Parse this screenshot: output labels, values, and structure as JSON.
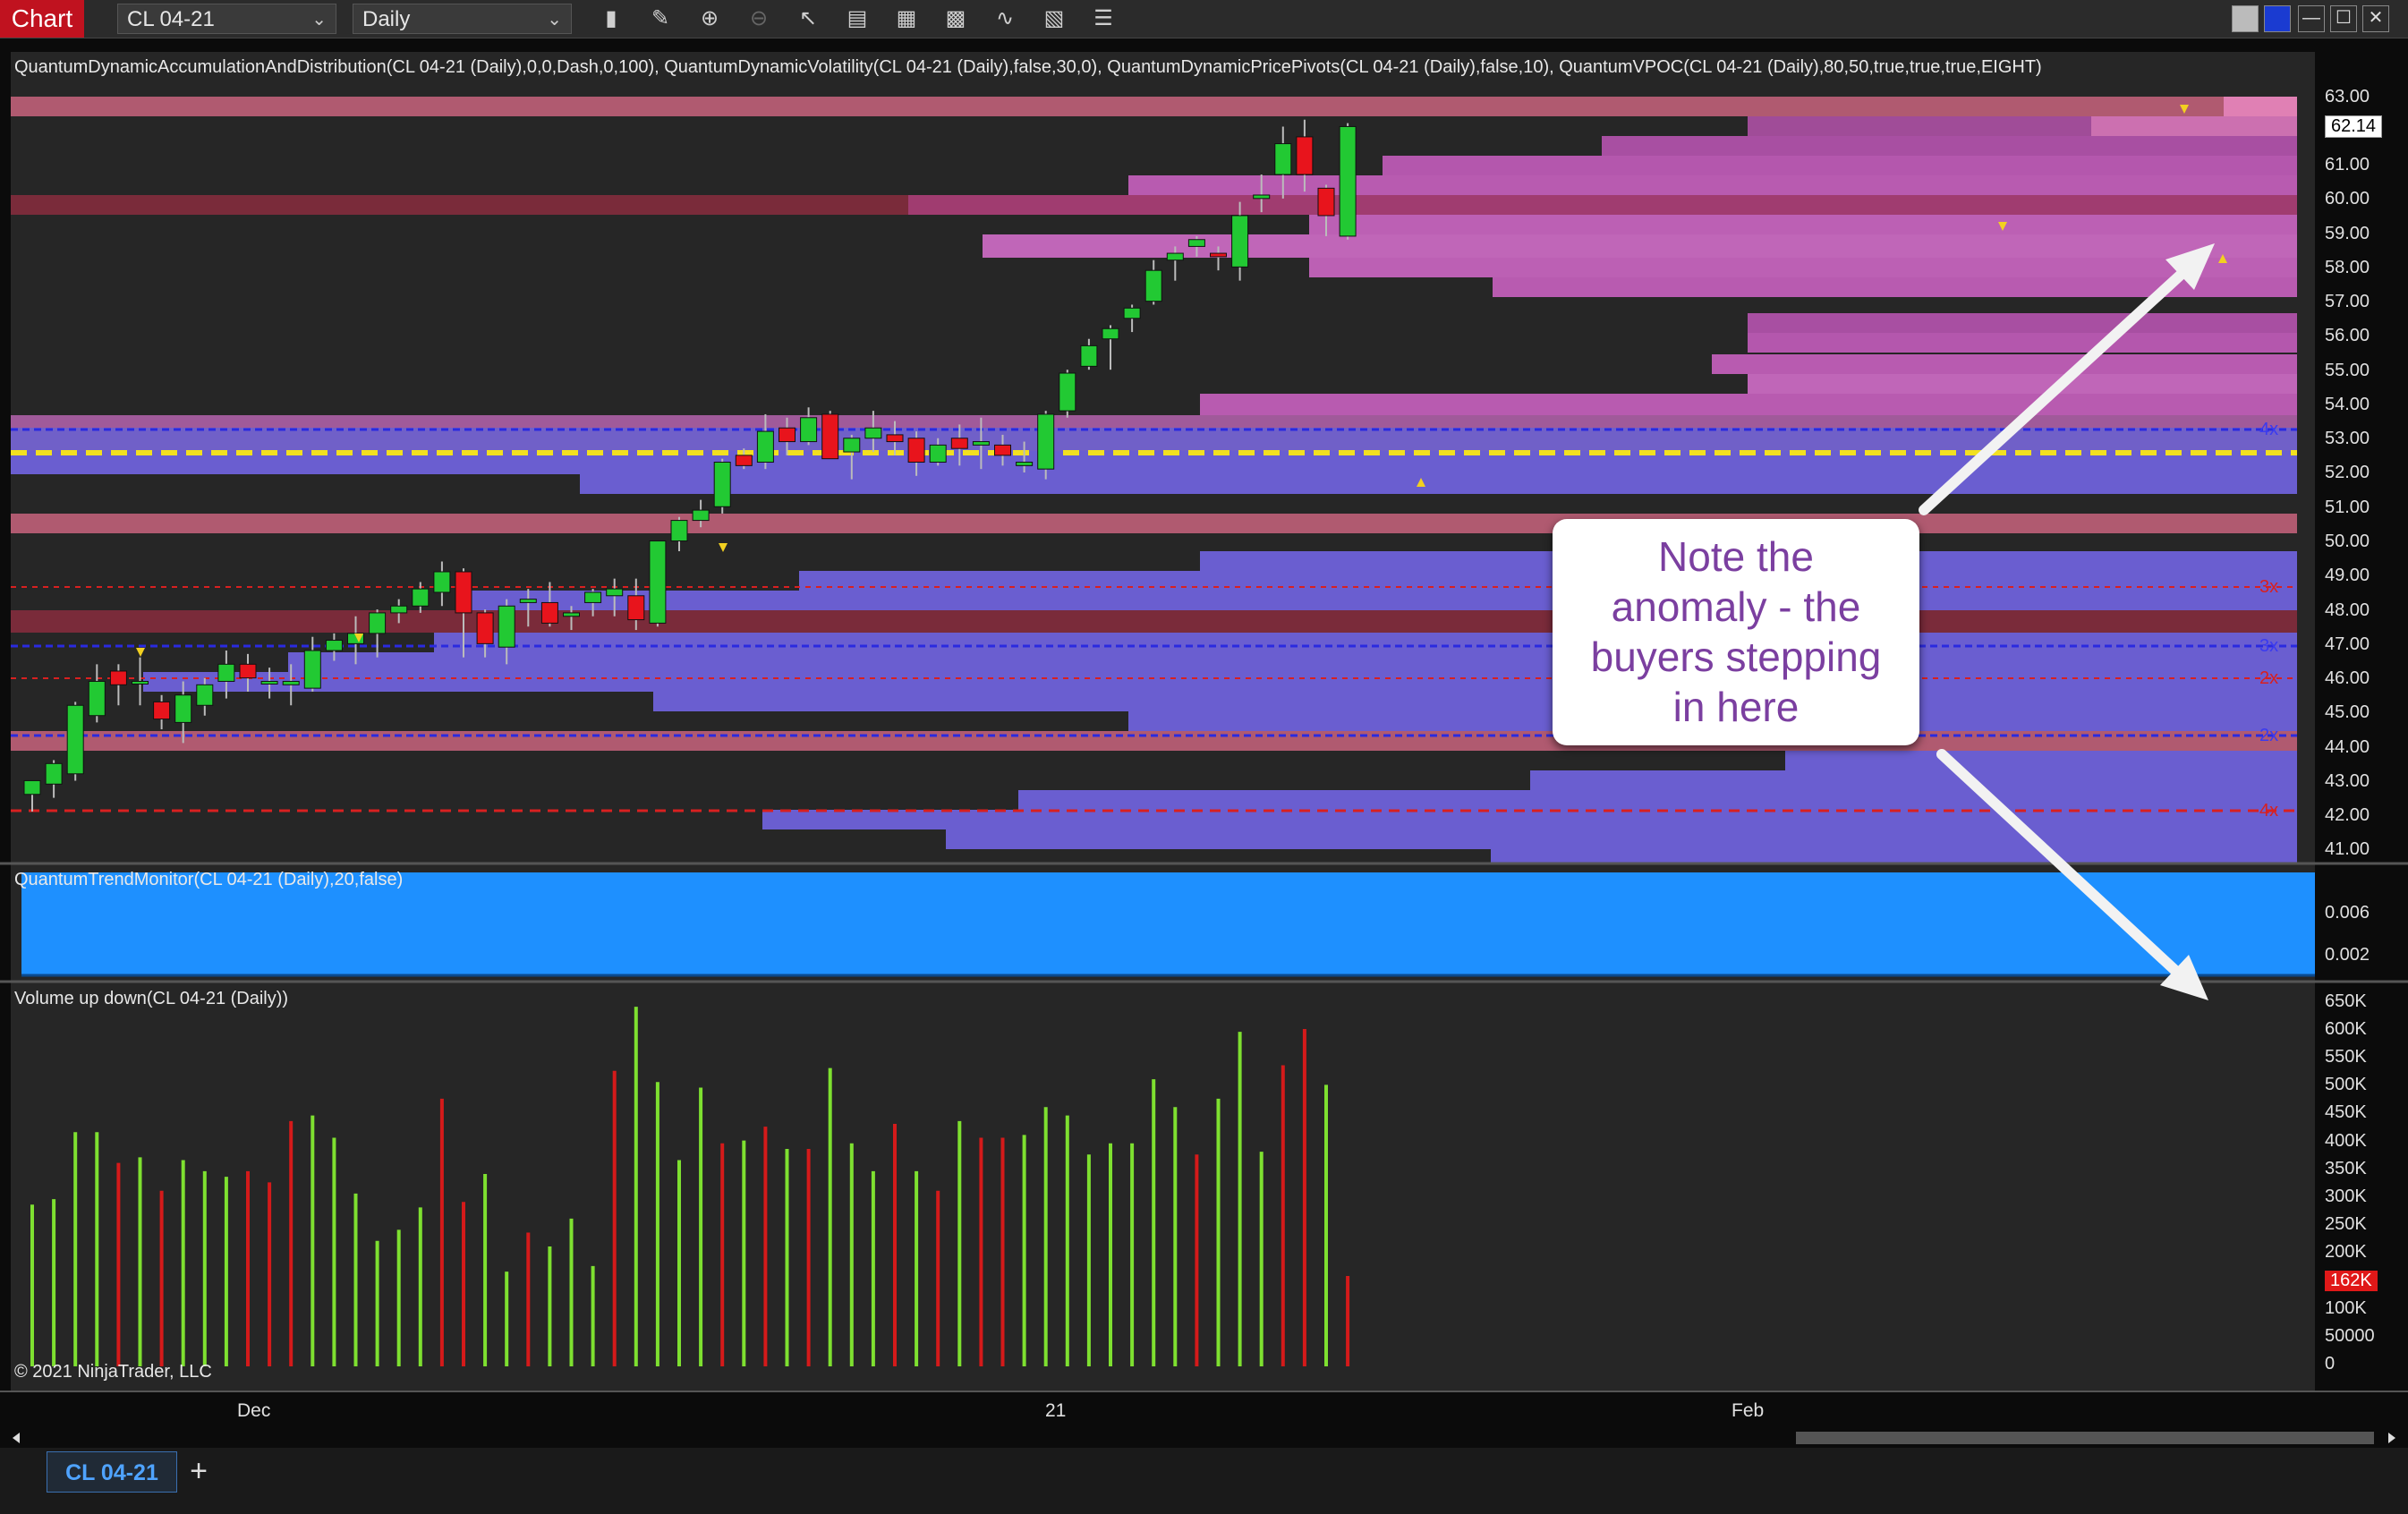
{
  "toolbar": {
    "chart_label": "Chart",
    "instrument": "CL 04-21",
    "period": "Daily",
    "icons": [
      "bar-type-icon",
      "draw-pencil-icon",
      "zoom-in-icon",
      "zoom-out-icon",
      "pointer-icon",
      "data-box-icon",
      "chart-style-icon",
      "indicators-icon",
      "strategies-icon",
      "properties-icon",
      "list-icon"
    ]
  },
  "panels": {
    "price_title": "QuantumDynamicAccumulationAndDistribution(CL 04-21 (Daily),0,0,Dash,0,100), QuantumDynamicVolatility(CL 04-21 (Daily),false,30,0), QuantumDynamicPricePivots(CL 04-21 (Daily),false,10), QuantumVPOC(CL 04-21 (Daily),80,50,true,true,true,EIGHT)",
    "trend_title": "QuantumTrendMonitor(CL 04-21 (Daily),20,false)",
    "volume_title": "Volume up down(CL 04-21 (Daily))",
    "copyright": "© 2021 NinjaTrader, LLC"
  },
  "price_axis": [
    "63.00",
    "62.00",
    "61.00",
    "60.00",
    "59.00",
    "58.00",
    "57.00",
    "56.00",
    "55.00",
    "54.00",
    "53.00",
    "52.00",
    "51.00",
    "50.00",
    "49.00",
    "48.00",
    "47.00",
    "46.00",
    "45.00",
    "44.00",
    "43.00",
    "42.00",
    "41.00"
  ],
  "last_price": "62.14",
  "trend_axis": [
    "0.006",
    "0.002"
  ],
  "volume_axis": [
    "650K",
    "600K",
    "550K",
    "500K",
    "450K",
    "400K",
    "350K",
    "300K",
    "250K",
    "200K",
    "150K",
    "100K",
    "50000",
    "0"
  ],
  "last_volume": "162K",
  "level_tags": [
    "4x",
    "3x",
    "3x",
    "2x",
    "2x",
    "4x"
  ],
  "date_labels": [
    "Dec",
    "21",
    "Feb"
  ],
  "callout": {
    "line1": "Note the",
    "line2": "anomaly - the",
    "line3": "buyers stepping",
    "line4": "in here"
  },
  "instrument_tab": "CL 04-21",
  "add_tab": "+",
  "colors": {
    "up": "#22c933",
    "down": "#e8141c",
    "vol_up": "#7ee030",
    "vol_down": "#d41a1a",
    "trend": "#1e90ff",
    "callout_text": "#7b3fa0"
  },
  "chart_data": {
    "type": "candlestick",
    "y_range": [
      40.5,
      63.4
    ],
    "candles": [
      {
        "o": 42.6,
        "h": 43.0,
        "l": 42.1,
        "c": 43.0
      },
      {
        "o": 42.9,
        "h": 43.6,
        "l": 42.5,
        "c": 43.5
      },
      {
        "o": 43.2,
        "h": 45.3,
        "l": 43.0,
        "c": 45.2
      },
      {
        "o": 44.9,
        "h": 46.4,
        "l": 44.7,
        "c": 45.9
      },
      {
        "o": 46.2,
        "h": 46.4,
        "l": 45.2,
        "c": 45.8
      },
      {
        "o": 45.9,
        "h": 46.6,
        "l": 45.2,
        "c": 45.9
      },
      {
        "o": 45.3,
        "h": 45.5,
        "l": 44.5,
        "c": 44.8
      },
      {
        "o": 44.7,
        "h": 45.9,
        "l": 44.1,
        "c": 45.5
      },
      {
        "o": 45.2,
        "h": 46.0,
        "l": 44.9,
        "c": 45.8
      },
      {
        "o": 45.9,
        "h": 46.8,
        "l": 45.4,
        "c": 46.4
      },
      {
        "o": 46.4,
        "h": 46.7,
        "l": 45.6,
        "c": 46.0
      },
      {
        "o": 45.9,
        "h": 46.3,
        "l": 45.4,
        "c": 45.9
      },
      {
        "o": 45.8,
        "h": 46.4,
        "l": 45.2,
        "c": 45.9
      },
      {
        "o": 45.7,
        "h": 47.2,
        "l": 45.6,
        "c": 46.8
      },
      {
        "o": 46.8,
        "h": 47.3,
        "l": 46.5,
        "c": 47.1
      },
      {
        "o": 47.0,
        "h": 47.8,
        "l": 46.4,
        "c": 47.3
      },
      {
        "o": 47.3,
        "h": 48.0,
        "l": 46.6,
        "c": 47.9
      },
      {
        "o": 47.9,
        "h": 48.3,
        "l": 47.6,
        "c": 48.1
      },
      {
        "o": 48.1,
        "h": 48.8,
        "l": 47.9,
        "c": 48.6
      },
      {
        "o": 48.5,
        "h": 49.4,
        "l": 48.1,
        "c": 49.1
      },
      {
        "o": 49.1,
        "h": 49.2,
        "l": 46.6,
        "c": 47.9
      },
      {
        "o": 47.9,
        "h": 48.0,
        "l": 46.6,
        "c": 47.0
      },
      {
        "o": 46.9,
        "h": 48.3,
        "l": 46.4,
        "c": 48.1
      },
      {
        "o": 48.2,
        "h": 48.6,
        "l": 47.5,
        "c": 48.3
      },
      {
        "o": 48.2,
        "h": 48.8,
        "l": 47.5,
        "c": 47.6
      },
      {
        "o": 47.8,
        "h": 48.1,
        "l": 47.4,
        "c": 47.9
      },
      {
        "o": 48.2,
        "h": 48.6,
        "l": 47.8,
        "c": 48.5
      },
      {
        "o": 48.4,
        "h": 48.9,
        "l": 47.8,
        "c": 48.6
      },
      {
        "o": 48.4,
        "h": 48.9,
        "l": 47.4,
        "c": 47.7
      },
      {
        "o": 47.6,
        "h": 50.0,
        "l": 47.5,
        "c": 50.0
      },
      {
        "o": 50.0,
        "h": 50.7,
        "l": 49.7,
        "c": 50.6
      },
      {
        "o": 50.6,
        "h": 51.2,
        "l": 50.4,
        "c": 50.9
      },
      {
        "o": 51.0,
        "h": 52.4,
        "l": 50.8,
        "c": 52.3
      },
      {
        "o": 52.5,
        "h": 52.7,
        "l": 52.1,
        "c": 52.2
      },
      {
        "o": 52.3,
        "h": 53.7,
        "l": 52.1,
        "c": 53.2
      },
      {
        "o": 53.3,
        "h": 53.6,
        "l": 52.5,
        "c": 52.9
      },
      {
        "o": 52.9,
        "h": 53.9,
        "l": 52.8,
        "c": 53.6
      },
      {
        "o": 53.7,
        "h": 53.8,
        "l": 52.4,
        "c": 52.4
      },
      {
        "o": 52.6,
        "h": 53.1,
        "l": 51.8,
        "c": 53.0
      },
      {
        "o": 53.0,
        "h": 53.8,
        "l": 52.6,
        "c": 53.3
      },
      {
        "o": 53.1,
        "h": 53.5,
        "l": 52.5,
        "c": 52.9
      },
      {
        "o": 53.0,
        "h": 53.2,
        "l": 51.9,
        "c": 52.3
      },
      {
        "o": 52.3,
        "h": 53.0,
        "l": 52.2,
        "c": 52.8
      },
      {
        "o": 53.0,
        "h": 53.4,
        "l": 52.2,
        "c": 52.7
      },
      {
        "o": 52.8,
        "h": 53.6,
        "l": 52.1,
        "c": 52.9
      },
      {
        "o": 52.8,
        "h": 53.1,
        "l": 52.2,
        "c": 52.5
      },
      {
        "o": 52.2,
        "h": 52.9,
        "l": 52.0,
        "c": 52.3
      },
      {
        "o": 52.1,
        "h": 53.8,
        "l": 51.8,
        "c": 53.7
      },
      {
        "o": 53.8,
        "h": 55.0,
        "l": 53.6,
        "c": 54.9
      },
      {
        "o": 55.1,
        "h": 55.9,
        "l": 55.0,
        "c": 55.7
      },
      {
        "o": 55.9,
        "h": 56.3,
        "l": 55.0,
        "c": 56.2
      },
      {
        "o": 56.5,
        "h": 56.9,
        "l": 56.1,
        "c": 56.8
      },
      {
        "o": 57.0,
        "h": 58.2,
        "l": 56.9,
        "c": 57.9
      },
      {
        "o": 58.2,
        "h": 58.6,
        "l": 57.6,
        "c": 58.4
      },
      {
        "o": 58.6,
        "h": 58.9,
        "l": 58.3,
        "c": 58.8
      },
      {
        "o": 58.4,
        "h": 58.6,
        "l": 57.9,
        "c": 58.3
      },
      {
        "o": 58.0,
        "h": 59.9,
        "l": 57.6,
        "c": 59.5
      },
      {
        "o": 60.0,
        "h": 60.7,
        "l": 59.6,
        "c": 60.1
      },
      {
        "o": 60.7,
        "h": 62.1,
        "l": 60.0,
        "c": 61.6
      },
      {
        "o": 61.8,
        "h": 62.3,
        "l": 60.2,
        "c": 60.7
      },
      {
        "o": 60.3,
        "h": 60.4,
        "l": 58.9,
        "c": 59.5
      },
      {
        "o": 58.9,
        "h": 62.2,
        "l": 58.8,
        "c": 62.1
      }
    ],
    "volume": [
      {
        "v": 290,
        "up": true
      },
      {
        "v": 300,
        "up": true
      },
      {
        "v": 420,
        "up": true
      },
      {
        "v": 420,
        "up": true
      },
      {
        "v": 365,
        "up": false
      },
      {
        "v": 375,
        "up": true
      },
      {
        "v": 315,
        "up": false
      },
      {
        "v": 370,
        "up": true
      },
      {
        "v": 350,
        "up": true
      },
      {
        "v": 340,
        "up": true
      },
      {
        "v": 350,
        "up": false
      },
      {
        "v": 330,
        "up": false
      },
      {
        "v": 440,
        "up": false
      },
      {
        "v": 450,
        "up": true
      },
      {
        "v": 410,
        "up": true
      },
      {
        "v": 310,
        "up": true
      },
      {
        "v": 225,
        "up": true
      },
      {
        "v": 245,
        "up": true
      },
      {
        "v": 285,
        "up": true
      },
      {
        "v": 480,
        "up": false
      },
      {
        "v": 295,
        "up": false
      },
      {
        "v": 345,
        "up": true
      },
      {
        "v": 170,
        "up": true
      },
      {
        "v": 240,
        "up": false
      },
      {
        "v": 215,
        "up": true
      },
      {
        "v": 265,
        "up": true
      },
      {
        "v": 180,
        "up": true
      },
      {
        "v": 530,
        "up": false
      },
      {
        "v": 645,
        "up": true
      },
      {
        "v": 510,
        "up": true
      },
      {
        "v": 370,
        "up": true
      },
      {
        "v": 500,
        "up": true
      },
      {
        "v": 400,
        "up": false
      },
      {
        "v": 405,
        "up": true
      },
      {
        "v": 430,
        "up": false
      },
      {
        "v": 390,
        "up": true
      },
      {
        "v": 390,
        "up": false
      },
      {
        "v": 535,
        "up": true
      },
      {
        "v": 400,
        "up": true
      },
      {
        "v": 350,
        "up": true
      },
      {
        "v": 435,
        "up": false
      },
      {
        "v": 350,
        "up": true
      },
      {
        "v": 315,
        "up": false
      },
      {
        "v": 440,
        "up": true
      },
      {
        "v": 410,
        "up": false
      },
      {
        "v": 410,
        "up": false
      },
      {
        "v": 415,
        "up": true
      },
      {
        "v": 465,
        "up": true
      },
      {
        "v": 450,
        "up": true
      },
      {
        "v": 380,
        "up": true
      },
      {
        "v": 400,
        "up": true
      },
      {
        "v": 400,
        "up": true
      },
      {
        "v": 515,
        "up": true
      },
      {
        "v": 465,
        "up": true
      },
      {
        "v": 380,
        "up": false
      },
      {
        "v": 480,
        "up": true
      },
      {
        "v": 600,
        "up": true
      },
      {
        "v": 385,
        "up": true
      },
      {
        "v": 540,
        "up": false
      },
      {
        "v": 605,
        "up": false
      },
      {
        "v": 505,
        "up": true
      },
      {
        "v": 162,
        "up": false
      }
    ]
  }
}
